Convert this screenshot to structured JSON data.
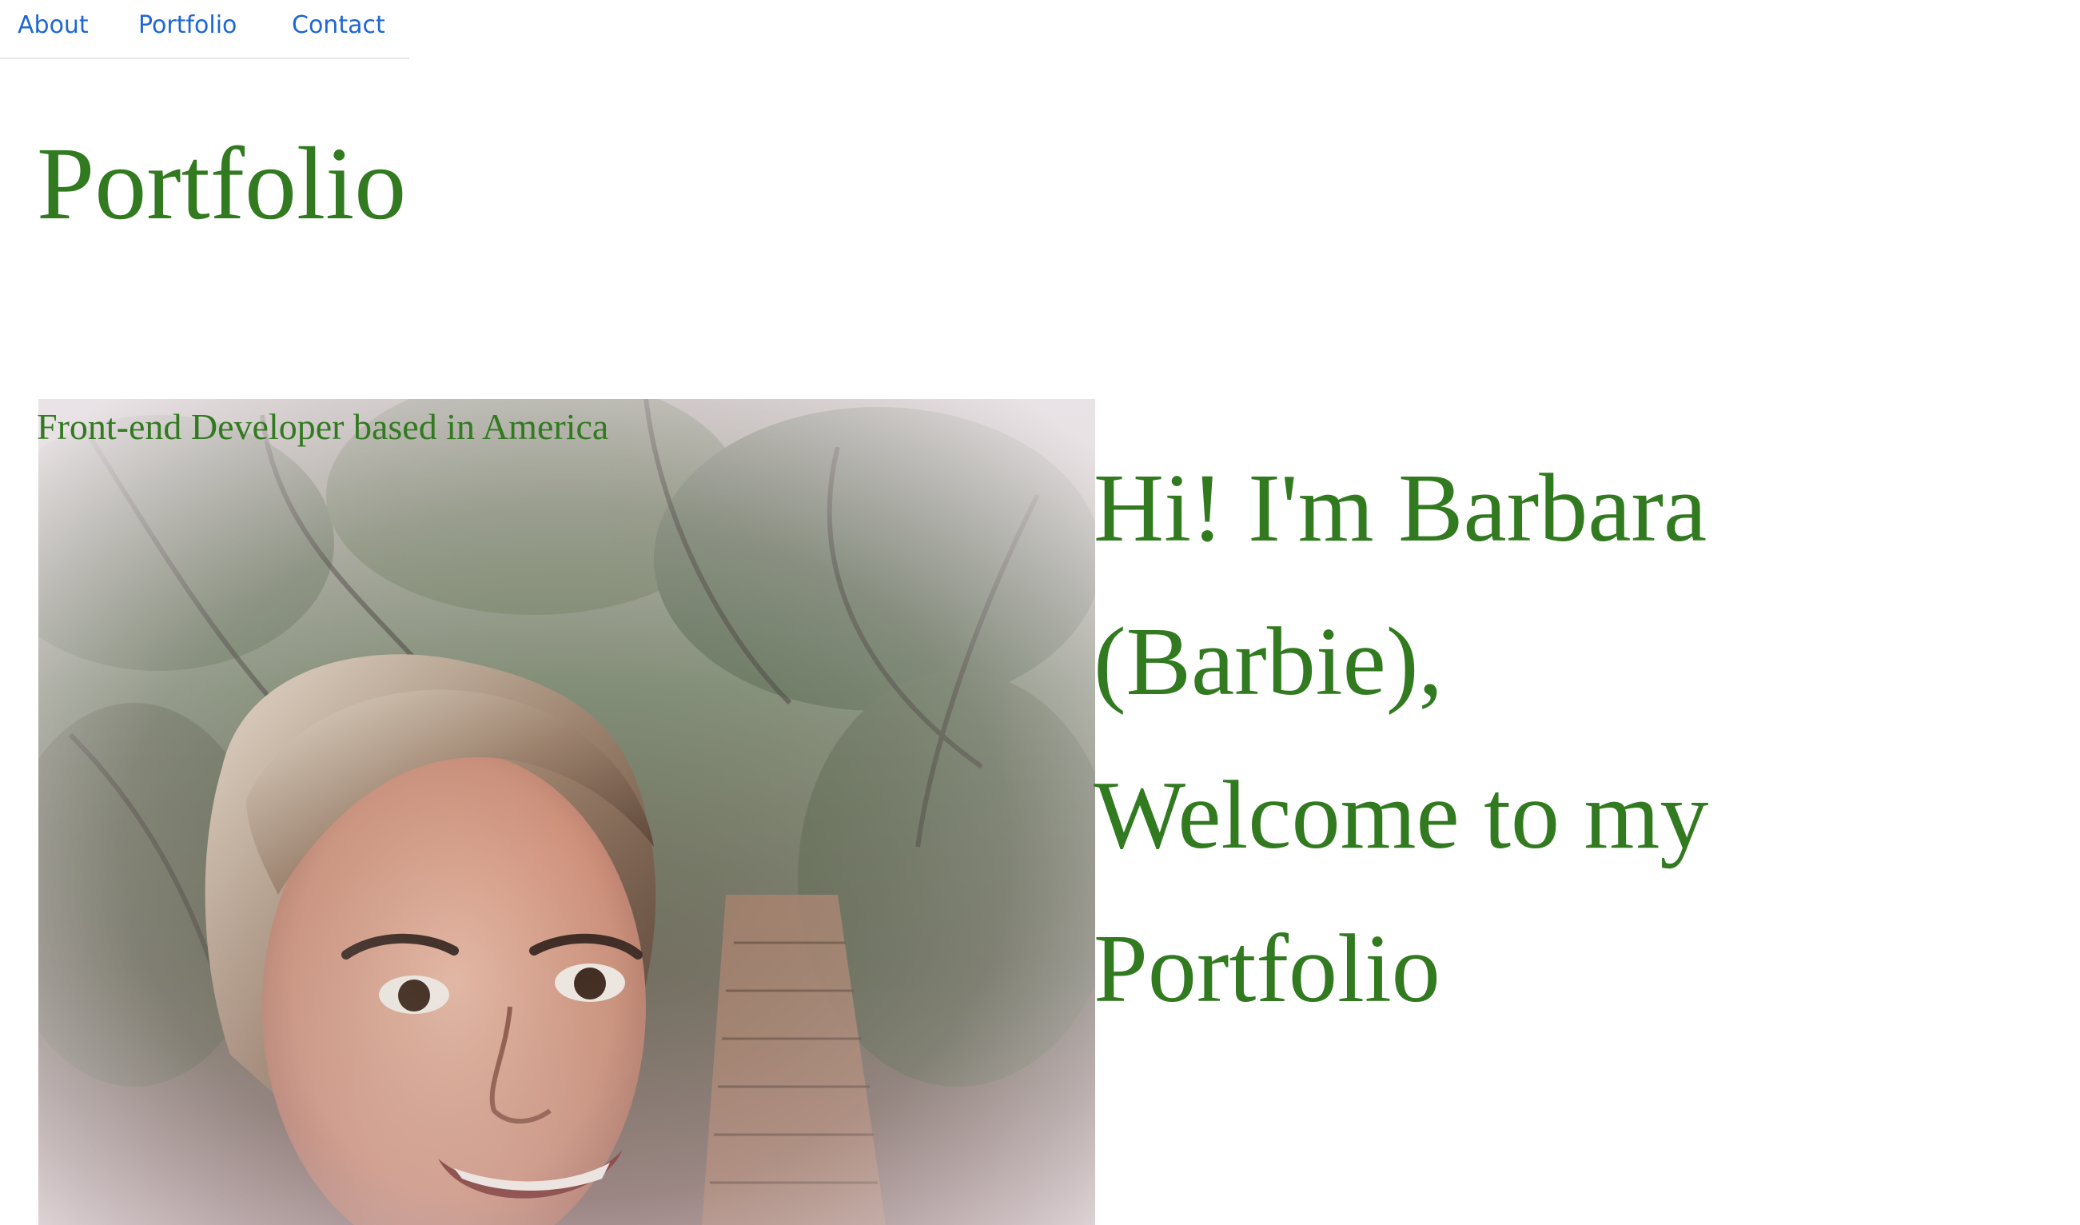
{
  "nav": {
    "items": [
      {
        "label": "About"
      },
      {
        "label": "Portfolio"
      },
      {
        "label": "Contact"
      }
    ],
    "link_color": "#1f66d6"
  },
  "header": {
    "title": "Portfolio"
  },
  "hero": {
    "tagline": "Front-end Developer based in America",
    "greeting_lines": [
      "Hi! I'm Barbara",
      "(Barbie),",
      "Welcome to my",
      "Portfolio"
    ],
    "text_color": "#327a20"
  }
}
